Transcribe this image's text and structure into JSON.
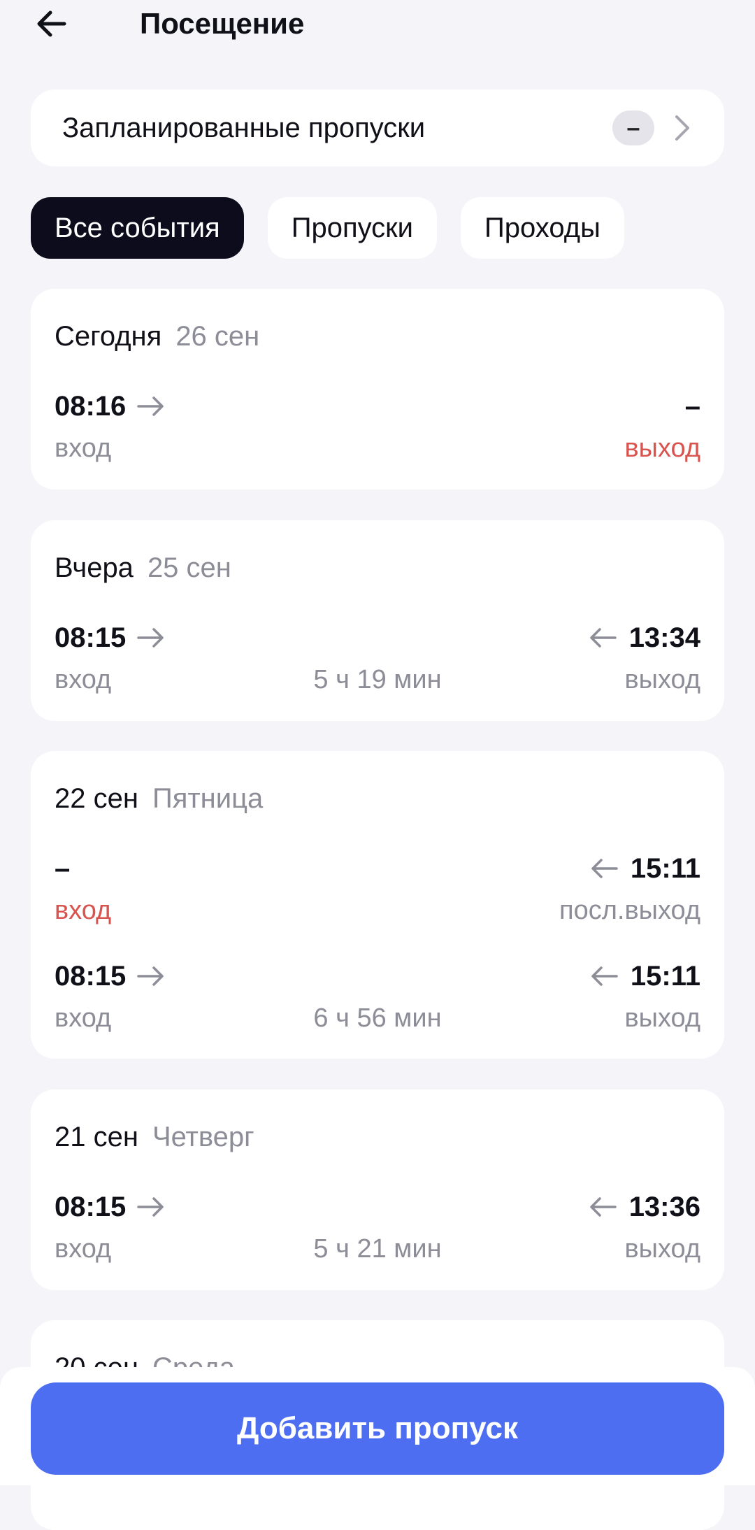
{
  "header": {
    "title": "Посещение"
  },
  "planned": {
    "label": "Запланированные пропуски",
    "badge": "–"
  },
  "filters": [
    "Все события",
    "Пропуски",
    "Проходы"
  ],
  "days": [
    {
      "title": "Сегодня",
      "subtitle": "26 сен",
      "entries": [
        {
          "in_time": "08:16",
          "in_label": "вход",
          "out_time": "–",
          "out_label": "выход",
          "duration": ""
        }
      ]
    },
    {
      "title": "Вчера",
      "subtitle": "25 сен",
      "entries": [
        {
          "in_time": "08:15",
          "in_label": "вход",
          "out_time": "13:34",
          "out_label": "выход",
          "duration": "5 ч 19 мин"
        }
      ]
    },
    {
      "title": "22 сен",
      "subtitle": "Пятница",
      "entries": [
        {
          "in_time": "–",
          "in_label": "вход",
          "out_time": "15:11",
          "out_label": "посл.выход",
          "duration": ""
        },
        {
          "in_time": "08:15",
          "in_label": "вход",
          "out_time": "15:11",
          "out_label": "выход",
          "duration": "6 ч 56 мин"
        }
      ]
    },
    {
      "title": "21 сен",
      "subtitle": "Четверг",
      "entries": [
        {
          "in_time": "08:15",
          "in_label": "вход",
          "out_time": "13:36",
          "out_label": "выход",
          "duration": "5 ч 21 мин"
        }
      ]
    },
    {
      "title": "20 сен",
      "subtitle": "Среда",
      "entries": []
    }
  ],
  "bottom": {
    "add_button": "Добавить пропуск"
  },
  "colors": {
    "accent": "#4d6ef1",
    "missing": "#d9534f",
    "active_tab": "#0c0c1c"
  }
}
